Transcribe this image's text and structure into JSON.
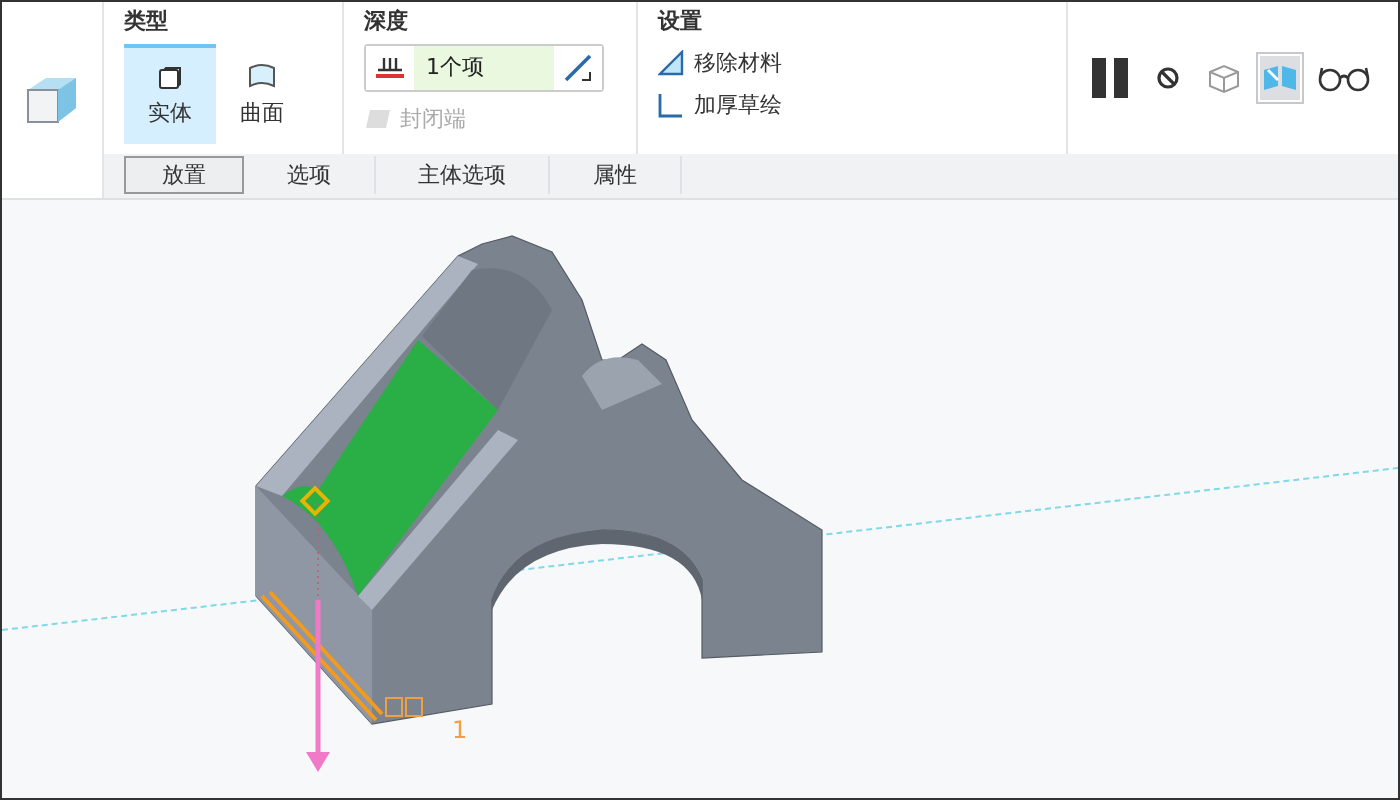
{
  "type_group": {
    "title": "类型",
    "options": [
      {
        "label": "实体",
        "kind": "solid",
        "selected": true
      },
      {
        "label": "曲面",
        "kind": "surface",
        "selected": false
      }
    ]
  },
  "depth_group": {
    "title": "深度",
    "value": "1个项",
    "capped_ends": {
      "label": "封闭端",
      "disabled": true
    }
  },
  "settings_group": {
    "title": "设置",
    "options": [
      {
        "label": "移除材料",
        "kind": "remove"
      },
      {
        "label": "加厚草绘",
        "kind": "thicken"
      }
    ]
  },
  "controls": [
    {
      "kind": "pause",
      "selected": false
    },
    {
      "kind": "stop",
      "selected": false
    },
    {
      "kind": "preview",
      "selected": false
    },
    {
      "kind": "verify",
      "selected": true
    },
    {
      "kind": "glasses",
      "selected": false
    }
  ],
  "tabs": [
    {
      "label": "放置",
      "selected": true
    },
    {
      "label": "选项",
      "selected": false
    },
    {
      "label": "主体选项",
      "selected": false
    },
    {
      "label": "属性",
      "selected": false
    }
  ],
  "viewport": {
    "dimension_label": "1"
  }
}
